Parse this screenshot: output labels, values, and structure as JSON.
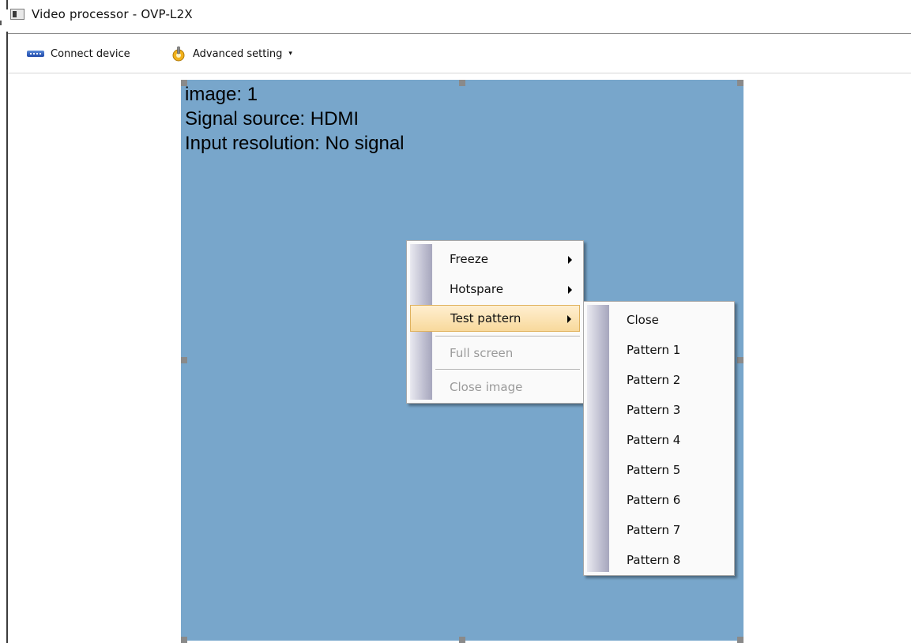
{
  "window": {
    "title": "Video processor  -  OVP-L2X",
    "icon": "app-window-icon"
  },
  "toolbar": {
    "connect_label": "Connect device",
    "connect_icon": "network-cable-icon",
    "advanced_label": "Advanced setting",
    "advanced_icon": "gear-wrench-icon",
    "advanced_caret": "▾"
  },
  "canvas": {
    "color": "#78a6cb",
    "image_label": "image: 1",
    "signal_source": "Signal source: HDMI",
    "input_resolution": "Input resolution: No signal"
  },
  "context_menu": {
    "items": [
      {
        "label": "Freeze",
        "has_submenu": true,
        "enabled": true
      },
      {
        "label": "Hotspare",
        "has_submenu": true,
        "enabled": true
      },
      {
        "label": "Test pattern",
        "has_submenu": true,
        "enabled": true,
        "highlighted": true
      },
      {
        "label": "Full screen",
        "has_submenu": false,
        "enabled": false
      },
      {
        "label": "Close image",
        "has_submenu": false,
        "enabled": false
      }
    ]
  },
  "test_pattern_submenu": {
    "items": [
      {
        "label": "Close"
      },
      {
        "label": "Pattern 1"
      },
      {
        "label": "Pattern 2"
      },
      {
        "label": "Pattern 3"
      },
      {
        "label": "Pattern 4"
      },
      {
        "label": "Pattern 5"
      },
      {
        "label": "Pattern 6"
      },
      {
        "label": "Pattern 7"
      },
      {
        "label": "Pattern 8"
      }
    ]
  },
  "colors": {
    "canvas": "#78a6cb",
    "menu_highlight": "#f8d99c",
    "disabled_text": "#9a9a9a"
  }
}
